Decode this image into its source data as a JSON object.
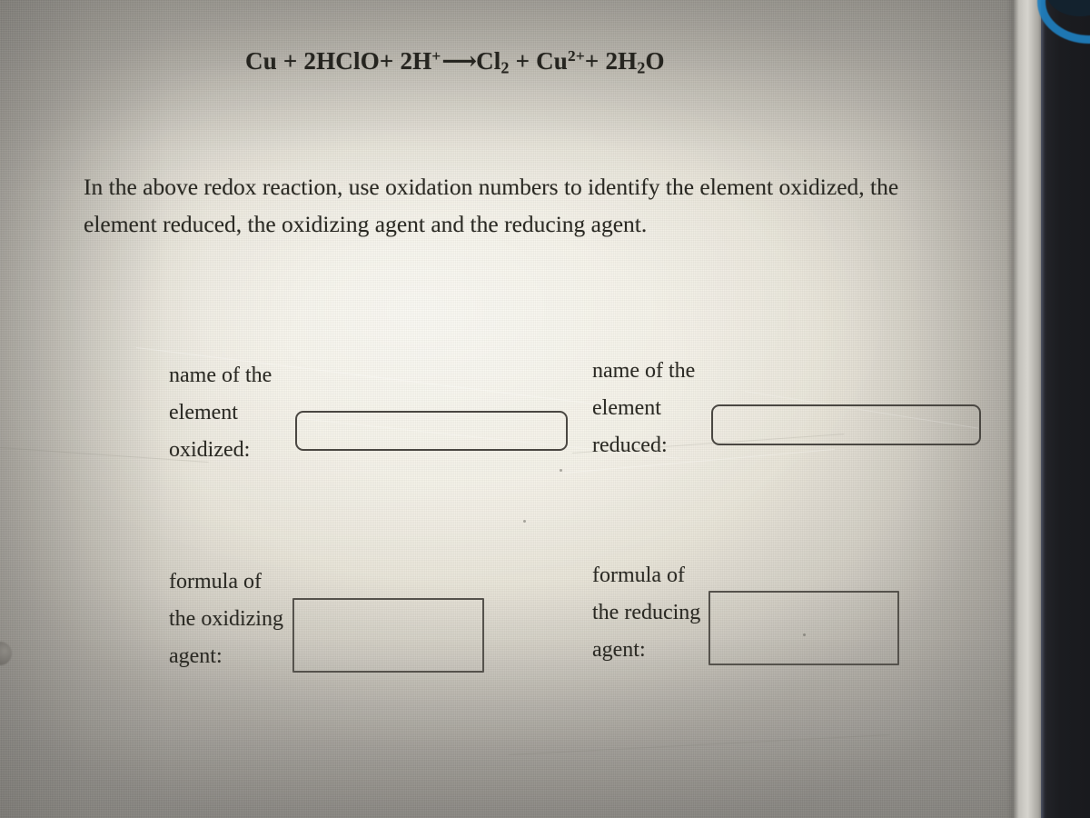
{
  "document": {
    "equation": {
      "full_text": "Cu + 2HClO+ 2H+ ——→ Cl2 + Cu2+ + 2H2O",
      "parts": [
        {
          "text": "Cu + 2HClO+ 2H",
          "type": "normal"
        },
        {
          "text": "+",
          "type": "sup"
        },
        {
          "text": "⟶",
          "type": "arrow"
        },
        {
          "text": "Cl",
          "type": "normal"
        },
        {
          "text": "2",
          "type": "sub"
        },
        {
          "text": " + Cu",
          "type": "normal"
        },
        {
          "text": "2+",
          "type": "sup"
        },
        {
          "text": "+ 2H",
          "type": "normal"
        },
        {
          "text": "2",
          "type": "sub"
        },
        {
          "text": "O",
          "type": "normal"
        }
      ],
      "reactant_left": "Cu + 2HClO+ 2H",
      "reactant_charge": "+",
      "arrow_glyph": "⟶",
      "product_cl": "Cl",
      "product_cl_sub": "2",
      "product_plus_cu": " + Cu",
      "product_cu_charge": "2+",
      "product_plus_water": "+ 2H",
      "product_water_sub": "2",
      "product_water_o": "O"
    },
    "instruction": "In the above redox reaction, use oxidation numbers to identify the element oxidized, the element reduced, the oxidizing agent and the reducing agent."
  },
  "answer_fields": [
    {
      "id": "element-oxidized",
      "label": "name of the element oxidized:",
      "value": "",
      "placeholder": "",
      "box_style": "rounded"
    },
    {
      "id": "element-reduced",
      "label": "name of the element reduced:",
      "value": "",
      "placeholder": "",
      "box_style": "rounded"
    },
    {
      "id": "oxidizing-agent",
      "label": "formula of the oxidizing agent:",
      "value": "",
      "placeholder": "",
      "box_style": "rect"
    },
    {
      "id": "reducing-agent",
      "label": "formula of the reducing agent:",
      "value": "",
      "placeholder": "",
      "box_style": "rect"
    }
  ],
  "colors": {
    "paper_center": "#f2efe4",
    "paper_edge": "#a3a09a",
    "ink": "#2a2923",
    "box_border": "#4a4742",
    "bezel": "#1b1c20",
    "accent_blue": "#1f7fbf"
  }
}
